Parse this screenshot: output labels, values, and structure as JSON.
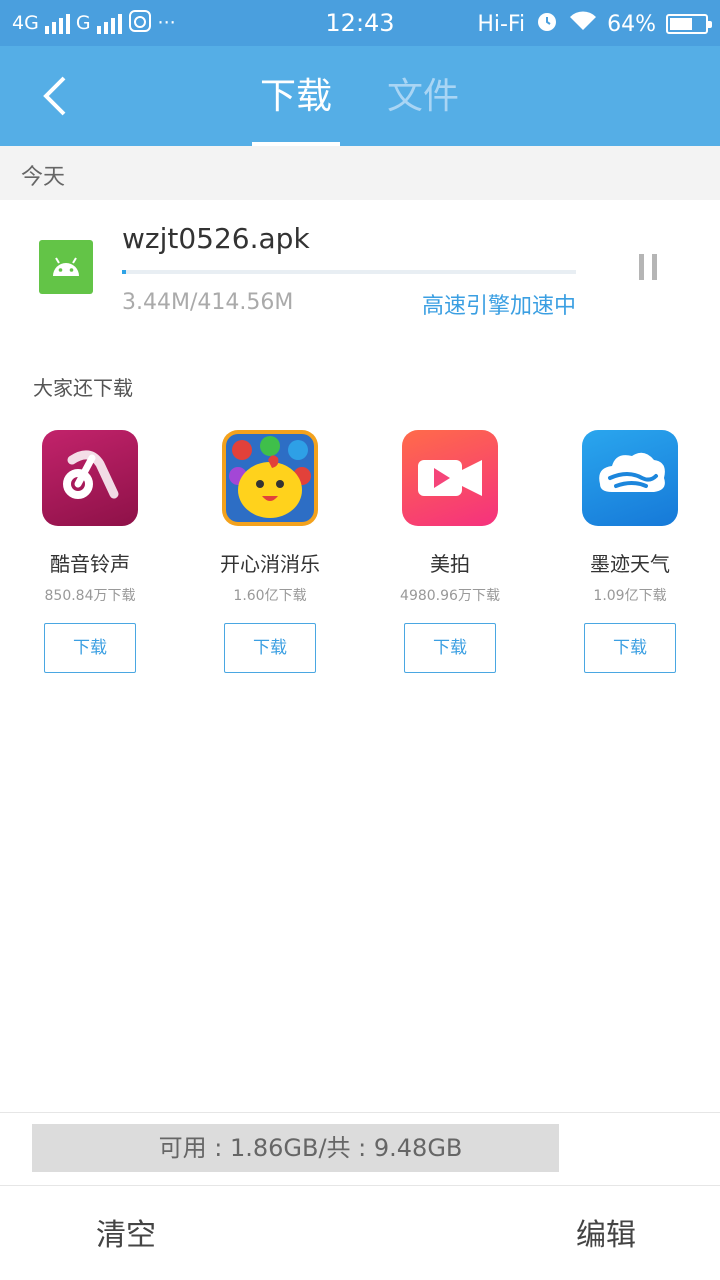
{
  "status_bar": {
    "network_1": "4G",
    "network_2": "G",
    "more": "···",
    "time": "12:43",
    "hifi": "Hi-Fi",
    "battery": "64%",
    "battery_level": 0.64
  },
  "header": {
    "tabs": [
      {
        "label": "下载",
        "active": true
      },
      {
        "label": "文件",
        "active": false
      }
    ],
    "accent_color": "#55aee6"
  },
  "section_today": "今天",
  "download": {
    "file_name": "wzjt0526.apk",
    "size_text": "3.44M/414.56M",
    "status": "高速引擎加速中",
    "progress": 0.0083,
    "icon": "android-icon"
  },
  "recommendations": {
    "title": "大家还下载",
    "items": [
      {
        "name": "酷音铃声",
        "count": "850.84万下载",
        "button": "下载",
        "icon": "ringtone-app-icon"
      },
      {
        "name": "开心消消乐",
        "count": "1.60亿下载",
        "button": "下载",
        "icon": "game-chick-icon"
      },
      {
        "name": "美拍",
        "count": "4980.96万下载",
        "button": "下载",
        "icon": "video-camera-icon"
      },
      {
        "name": "墨迹天气",
        "count": "1.09亿下载",
        "button": "下载",
        "icon": "weather-cloud-icon"
      }
    ]
  },
  "storage": {
    "text": "可用 : 1.86GB/共 : 9.48GB"
  },
  "bottom_bar": {
    "clear": "清空",
    "edit": "编辑"
  }
}
